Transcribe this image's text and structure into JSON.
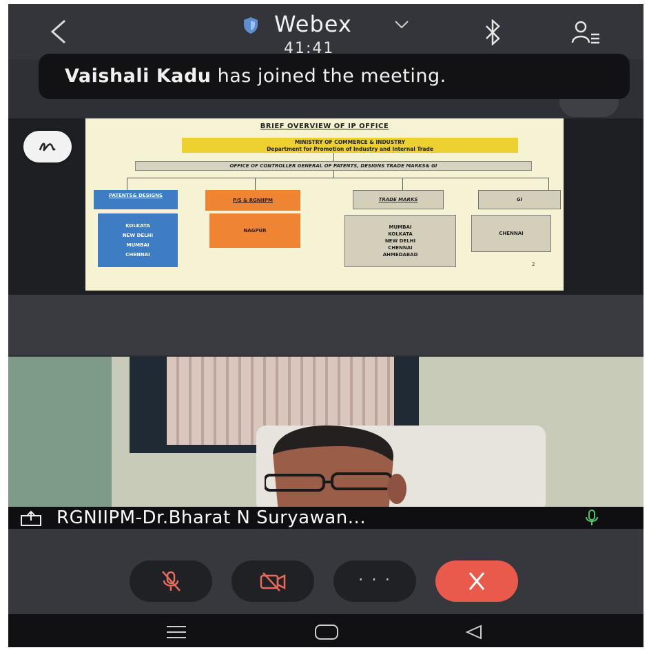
{
  "header": {
    "app_title": "Webex",
    "timer": "41:41",
    "back_icon": "back-chevron-icon",
    "security_icon": "shield-icon",
    "bluetooth_icon": "bluetooth-icon",
    "participants_icon": "participants-icon"
  },
  "toast": {
    "name": "Vaishali Kadu",
    "message": " has joined the meeting."
  },
  "slide": {
    "title": "BRIEF OVERVIEW OF IP OFFICE",
    "ministry_line1": "MINISTRY OF COMMERCE & INDUSTRY",
    "ministry_line2": "Department for Promotion of Industry and Internal Trade",
    "controller": "OFFICE OF CONTROLLER GENERAL OF PATENTS, DESIGNS TRADE MARKS& GI",
    "patents_head": "PATENTS& DESIGNS",
    "patents_list": [
      "KOLKATA",
      "NEW DELHI",
      "MUMBAI",
      "CHENNAI"
    ],
    "pis_head": "P/S & RGNIIPM",
    "pis_list": [
      "NAGPUR"
    ],
    "tm_head": "TRADE MARKS",
    "tm_list": [
      "MUMBAI",
      "KOLKATA",
      "NEW DELHI",
      "CHENNAI",
      "AHMEDABAD"
    ],
    "gi_head": "GI",
    "gi_list": [
      "CHENNAI"
    ],
    "page_num": "2",
    "colors": {
      "yellow": "#ecd131",
      "blue": "#3e7cc4",
      "orange": "#ef8432",
      "grey": "#d3cfbb"
    }
  },
  "video": {
    "participant_name": "RGNIIPM-Dr.Bharat N Suryawan...",
    "share_icon": "screen-share-icon",
    "mic_icon": "microphone-icon"
  },
  "controls": {
    "mute_icon": "mic-off-icon",
    "video_icon": "video-off-icon",
    "more_label": "· · ·",
    "end_icon": "end-call-icon",
    "end_color": "#ea5a4b"
  },
  "navbar": {
    "recents_icon": "recents-icon",
    "home_icon": "home-icon",
    "back_icon": "nav-back-icon"
  }
}
